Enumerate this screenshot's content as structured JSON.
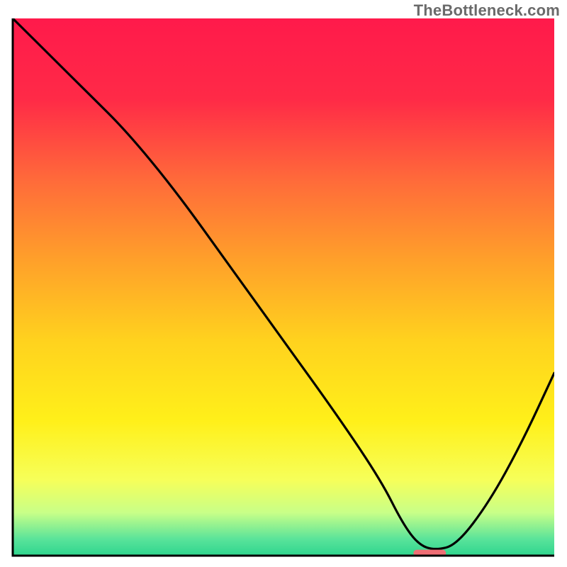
{
  "watermark": "TheBottleneck.com",
  "chart_data": {
    "type": "line",
    "title": "",
    "xlabel": "",
    "ylabel": "",
    "xlim": [
      0,
      100
    ],
    "ylim": [
      0,
      100
    ],
    "grid": false,
    "legend": false,
    "background": {
      "type": "vertical-gradient",
      "stops": [
        {
          "pos": 0.0,
          "color": "#ff1a4b"
        },
        {
          "pos": 0.15,
          "color": "#ff2a47"
        },
        {
          "pos": 0.3,
          "color": "#ff6a3a"
        },
        {
          "pos": 0.45,
          "color": "#ffa02a"
        },
        {
          "pos": 0.6,
          "color": "#ffd21e"
        },
        {
          "pos": 0.75,
          "color": "#fff01a"
        },
        {
          "pos": 0.86,
          "color": "#f6ff5a"
        },
        {
          "pos": 0.92,
          "color": "#c8ff88"
        },
        {
          "pos": 0.97,
          "color": "#58e39a"
        },
        {
          "pos": 1.0,
          "color": "#2fd58e"
        }
      ]
    },
    "series": [
      {
        "name": "bottleneck-curve",
        "color": "#000000",
        "x": [
          0,
          7,
          14,
          21,
          30,
          40,
          50,
          60,
          68,
          72,
          75,
          78,
          82,
          88,
          94,
          100
        ],
        "y": [
          100,
          93,
          86,
          79,
          68,
          54,
          40,
          26,
          14,
          6,
          2,
          1,
          2,
          10,
          21,
          34
        ]
      }
    ],
    "marker": {
      "name": "optimal-range",
      "shape": "pill",
      "color": "#ef6e75",
      "x": [
        74,
        80
      ],
      "y": 0.5,
      "height": 1.2
    }
  }
}
